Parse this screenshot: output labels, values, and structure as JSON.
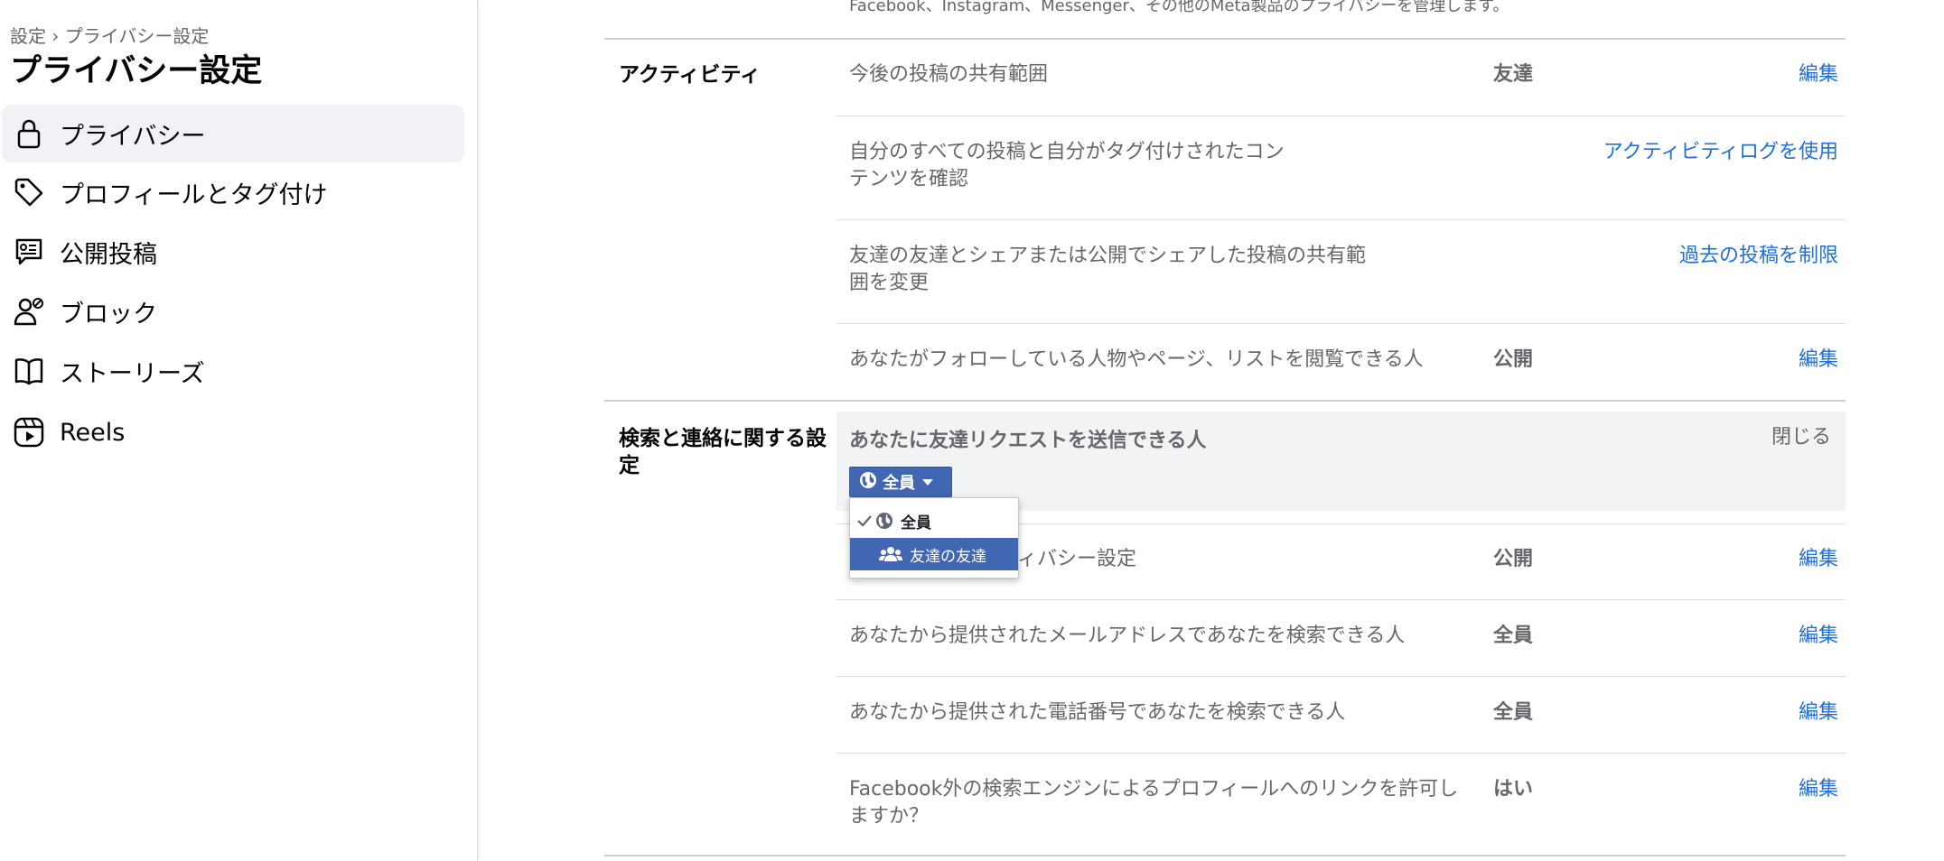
{
  "sidebar": {
    "breadcrumb": "設定 › プライバシー設定",
    "title": "プライバシー設定",
    "items": [
      {
        "label": "プライバシー",
        "icon": "lock-icon",
        "active": true
      },
      {
        "label": "プロフィールとタグ付け",
        "icon": "tag-icon"
      },
      {
        "label": "公開投稿",
        "icon": "public-posts-icon"
      },
      {
        "label": "ブロック",
        "icon": "block-user-icon"
      },
      {
        "label": "ストーリーズ",
        "icon": "book-icon"
      },
      {
        "label": "Reels",
        "icon": "reels-icon"
      }
    ]
  },
  "main": {
    "top_note": "Facebook、Instagram、Messenger、その他のMeta製品のプライバシーを管理します。",
    "activity": {
      "title": "アクティビティ",
      "rows": [
        {
          "desc": "今後の投稿の共有範囲",
          "value": "友達",
          "action": "編集"
        },
        {
          "desc_line1": "自分のすべての投稿と自分がタグ付けされたコン",
          "desc_line2": "テンツを確認",
          "value": "",
          "action": "アクティビティログを使用"
        },
        {
          "desc_line1": "友達の友達とシェアまたは公開でシェアした投稿の共有範",
          "desc_line2": "囲を変更",
          "value": "",
          "action": "過去の投稿を制限"
        },
        {
          "desc": "あなたがフォローしている人物やページ、リストを閲覧できる人",
          "value": "公開",
          "action": "編集"
        }
      ]
    },
    "search": {
      "title_line1": "検索と連絡に関する設",
      "title_line2": "定",
      "expanded": {
        "title": "あなたに友達リクエストを送信できる人",
        "close": "閉じる",
        "selected": "全員",
        "options": [
          "全員",
          "友達の友達"
        ]
      },
      "rows": [
        {
          "desc": "ィバシー設定",
          "value": "公開",
          "action": "編集"
        },
        {
          "desc": "あなたから提供されたメールアドレスであなたを検索できる人",
          "value": "全員",
          "action": "編集"
        },
        {
          "desc": "あなたから提供された電話番号であなたを検索できる人",
          "value": "全員",
          "action": "編集"
        },
        {
          "desc_line1": "Facebook外の検索エンジンによるプロフィールへのリンクを許可し",
          "desc_line2": "ますか？",
          "value": "はい",
          "action": "編集"
        }
      ]
    }
  },
  "colors": {
    "accent": "#4267b2",
    "link": "#216fdb",
    "active_bg": "#f0f2f5"
  }
}
